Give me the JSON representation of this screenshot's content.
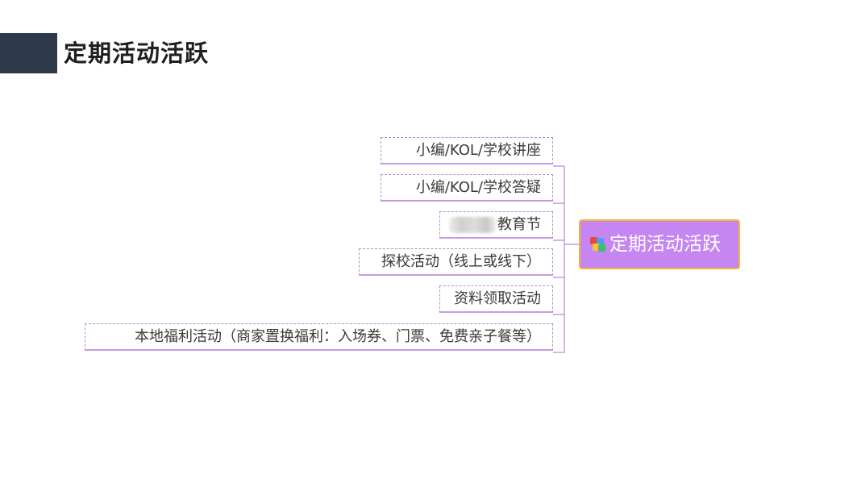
{
  "header": {
    "title": "定期活动活跃"
  },
  "mindmap": {
    "root": {
      "label": "定期活动活跃",
      "icon": "map-icon",
      "fill_color": "#c686f2",
      "border_color": "#f5b43a"
    },
    "branches": [
      {
        "label": "小编/KOL/学校讲座"
      },
      {
        "label": "小编/KOL/学校答疑"
      },
      {
        "label": "教育节",
        "prefix_obscured": true
      },
      {
        "label": "探校活动（线上或线下）"
      },
      {
        "label": "资料领取活动"
      },
      {
        "label": "本地福利活动（商家置换福利：入场券、门票、免费亲子餐等）"
      }
    ],
    "line_color": "#c99be4"
  }
}
